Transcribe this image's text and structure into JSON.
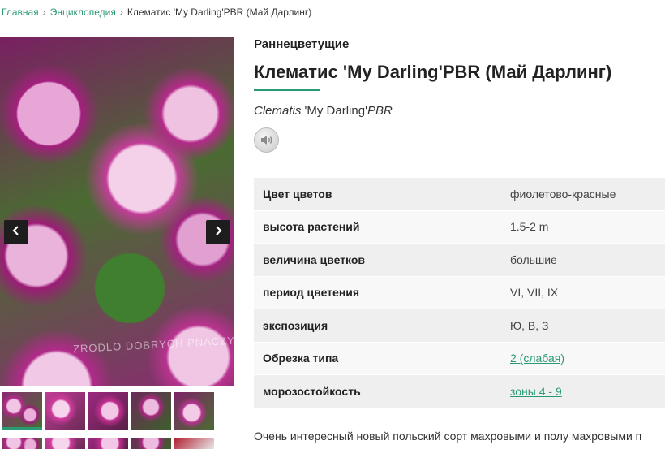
{
  "breadcrumb": {
    "home": "Главная",
    "encyclopedia": "Энциклопедия",
    "current": "Клематис 'My Darling'PBR (Май Дарлинг)"
  },
  "gallery": {
    "watermark": "ZRODLO DOBRYCH PNACZY",
    "prev_icon": "chevron-left-icon",
    "next_icon": "chevron-right-icon",
    "thumb_count_visible": 5
  },
  "product": {
    "category": "Раннецветущие",
    "title": "Клематис 'My Darling'PBR (Май Дарлинг)",
    "latin_genus": "Clematis",
    "latin_cultivar": " 'My Darling'",
    "latin_suffix": "PBR",
    "audio_icon": "speaker-icon"
  },
  "properties": [
    {
      "label": "Цвет цветов",
      "value": "фиолетово-красные",
      "link": false
    },
    {
      "label": "высота растений",
      "value": "1.5-2 m",
      "link": false
    },
    {
      "label": "величина цветков",
      "value": "большие",
      "link": false
    },
    {
      "label": "период цветения",
      "value": "VI, VII, IX",
      "link": false
    },
    {
      "label": "экспозиция",
      "value": "Ю, В, З",
      "link": false
    },
    {
      "label": "Обрезка типа",
      "value": "2 (слабая)",
      "link": true
    },
    {
      "label": "морозостойкость",
      "value": "зоны 4 - 9",
      "link": true
    }
  ],
  "description": "Очень интересный новый польский сорт махровыми и полу махровыми п",
  "colors": {
    "accent": "#2a9a73",
    "text": "#222222",
    "row_odd": "#efefef",
    "row_even": "#f8f8f8"
  }
}
